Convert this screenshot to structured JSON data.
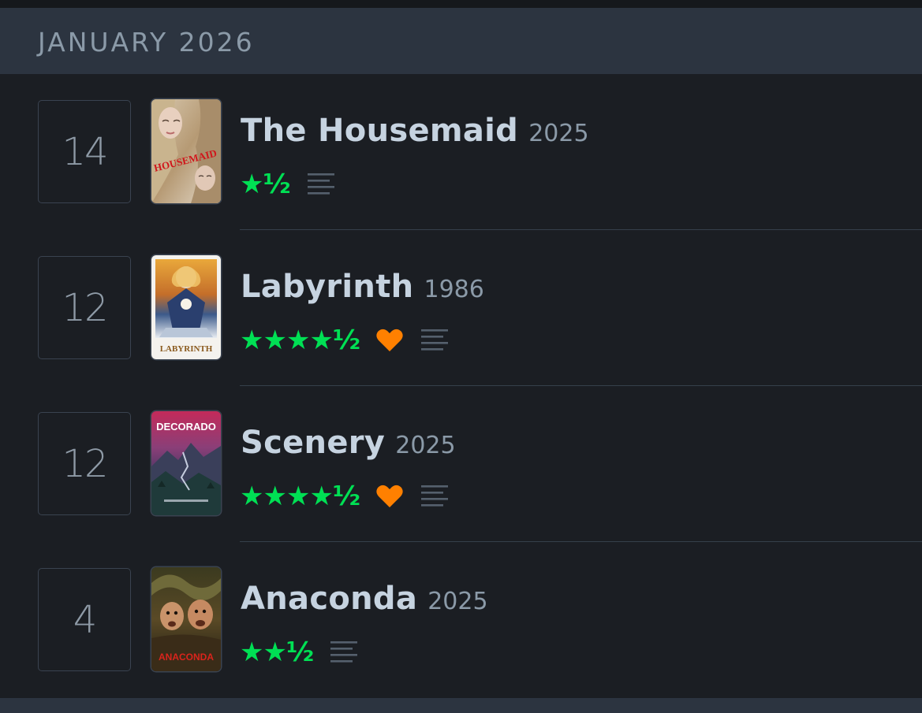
{
  "month": {
    "title": "JANUARY 2026"
  },
  "colors": {
    "star": "#00e054",
    "heart": "#ff8000",
    "header_bg": "#2c3440",
    "page_bg": "#1b1e23"
  },
  "entries": [
    {
      "day": "14",
      "title": "The Housemaid",
      "year": "2025",
      "rating_stars": 1.5,
      "rating_text": "★½",
      "liked": false,
      "has_review": true,
      "poster_text": "HOUSEMAID",
      "poster_icon": "housemaid-poster"
    },
    {
      "day": "12",
      "title": "Labyrinth",
      "year": "1986",
      "rating_stars": 4.5,
      "rating_text": "★★★★½",
      "liked": true,
      "has_review": true,
      "poster_text": "LABYRINTH",
      "poster_icon": "labyrinth-poster"
    },
    {
      "day": "12",
      "title": "Scenery",
      "year": "2025",
      "rating_stars": 4.5,
      "rating_text": "★★★★½",
      "liked": true,
      "has_review": true,
      "poster_text": "DECORADO",
      "poster_icon": "decorado-poster"
    },
    {
      "day": "4",
      "title": "Anaconda",
      "year": "2025",
      "rating_stars": 2.5,
      "rating_text": "★★½",
      "liked": false,
      "has_review": true,
      "poster_text": "ANACONDA",
      "poster_icon": "anaconda-poster"
    }
  ]
}
